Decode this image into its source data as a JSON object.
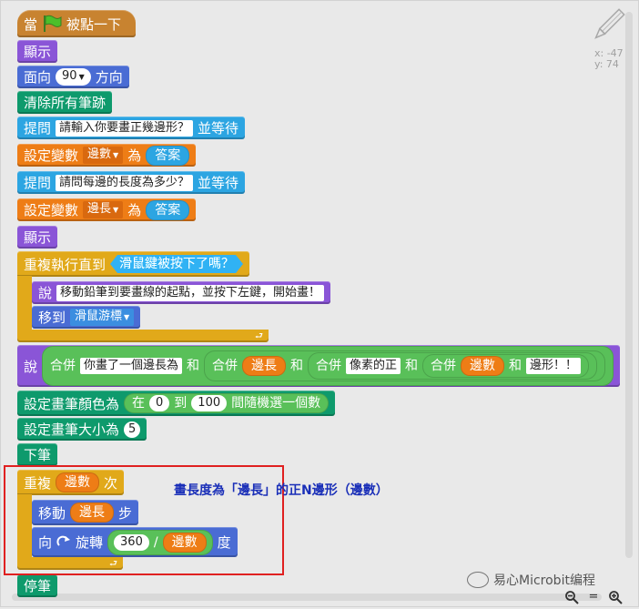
{
  "coords": {
    "x": "x: -47",
    "y": "y: 74"
  },
  "blocks": {
    "when_flag": {
      "pre": "當",
      "post": "被點一下"
    },
    "show1": "顯示",
    "point": {
      "label": "面向",
      "value": "90",
      "suffix": "方向"
    },
    "clear": "清除所有筆跡",
    "ask1": {
      "label": "提問",
      "text": "請輸入你要畫正幾邊形？",
      "suffix": "並等待"
    },
    "set1": {
      "label": "設定變數",
      "var": "邊數",
      "as": "為",
      "value": "答案"
    },
    "ask2": {
      "label": "提問",
      "text": "請問每邊的長度為多少？",
      "suffix": "並等待"
    },
    "set2": {
      "label": "設定變數",
      "var": "邊長",
      "as": "為",
      "value": "答案"
    },
    "show2": "顯示",
    "repeat_until": {
      "label": "重複執行直到",
      "cond": "滑鼠鍵被按下了嗎？"
    },
    "say1": {
      "label": "說",
      "text": "移動鉛筆到要畫線的起點，並按下左鍵，開始畫！"
    },
    "goto": {
      "label": "移到",
      "target": "滑鼠游標"
    },
    "say2": {
      "label": "說",
      "join": "合併",
      "and": "和",
      "t1": "你畫了一個邊長為",
      "v1": "邊長",
      "t2": "像素的正",
      "v2": "邊數",
      "t3": "邊形！！"
    },
    "set_color": {
      "label": "設定畫筆顏色為",
      "in": "在",
      "from": "0",
      "to_label": "到",
      "to": "100",
      "suffix": "間隨機選一個數"
    },
    "set_size": {
      "label": "設定畫筆大小為",
      "value": "5"
    },
    "pen_down": "下筆",
    "repeat": {
      "label": "重複",
      "var": "邊數",
      "suffix": "次"
    },
    "move": {
      "label": "移動",
      "var": "邊長",
      "suffix": "步"
    },
    "turn": {
      "label": "向",
      "rot": "旋轉",
      "num": "360",
      "div": "/",
      "var": "邊數",
      "suffix": "度"
    },
    "pen_up": "停筆"
  },
  "annotation": "畫長度為「邊長」的正N邊形（邊數）",
  "watermark": "易心Microbit编程",
  "zoom": {
    "out": "−",
    "reset": "=",
    "in": "+"
  },
  "colors": {
    "looks": "#8a55d7",
    "motion": "#4a6cd4",
    "pen": "#0e9a6c",
    "sensing": "#2ca5e2",
    "data": "#ee7d16",
    "control": "#e1a91a",
    "events": "#c88330",
    "highlight": "#e02020",
    "annotation": "#1a2fb8"
  },
  "icons": [
    "green-flag-icon",
    "rotate-right-icon",
    "pencil-icon",
    "zoom-out-icon",
    "zoom-reset-icon",
    "zoom-in-icon",
    "wechat-logo-icon"
  ]
}
